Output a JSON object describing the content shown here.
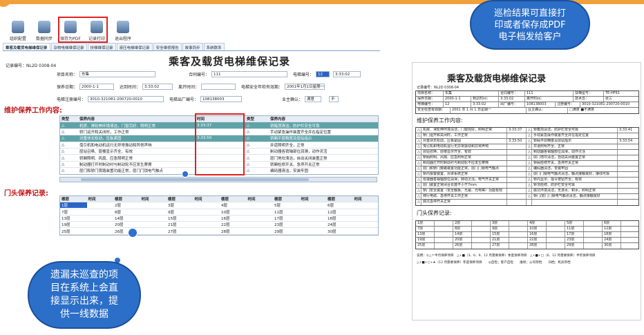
{
  "toolbar": {
    "buttons": [
      {
        "label": "组织配置",
        "icon": "organization-icon"
      },
      {
        "label": "数据同步",
        "icon": "sync-icon"
      },
      {
        "label": "保存为PDF",
        "icon": "save-pdf-icon"
      },
      {
        "label": "记录打印",
        "icon": "printer-icon"
      },
      {
        "label": "退出程序",
        "icon": "exit-icon"
      }
    ]
  },
  "tabs": [
    "乘客及载货电梯维保记录",
    "杂物电梯维保记录",
    "扶梯维保记录",
    "液压电梯维保记录",
    "安全维修报告",
    "故事同步",
    "系统联系"
  ],
  "form": {
    "record_no": "记录编号：NL2D 0308-04",
    "title": "乘客及载货电梯维保记录",
    "labels": {
      "project": "项目名称：",
      "contract": "合同编号：",
      "elevator_no": "电梯编号：",
      "date": "保养日期：",
      "arrive": "达到时间：",
      "leave": "离开时间：",
      "next_check": "电梯安全年检有效期：",
      "reg_code": "电梯注册编号：",
      "factory_no": "电梯出厂编号：",
      "owner": "业主确认："
    },
    "values": {
      "project": "东集",
      "contract": "111",
      "elevator_no": "12",
      "time1": "3:33:02",
      "date": "2000-1-1",
      "arrive": "3:33:02",
      "next_check": "2001年1月1日星期一",
      "reg_code": "3010-321081-200720-0010",
      "factory_no": "108138003",
      "owner_opts": [
        "满意",
        "不"
      ]
    }
  },
  "maintenance": {
    "title": "维护保养工作内容:",
    "headers": [
      "类型",
      "保养内容",
      "时间",
      "类型",
      "保养内容"
    ],
    "rows": [
      [
        "△",
        "机房、滑轮伸环境清洁，门窗完好、照明正常",
        "3:33:37",
        "△",
        "轿箱顶清洁，防护栏安全可靠"
      ],
      [
        "△",
        "轿门运开和关闭时，工作正常",
        "",
        "△",
        "手动紧急操作装置齐全并在指定位置"
      ],
      [
        "△",
        "对重块无松动，压板紧固",
        "3:33:50",
        "△",
        "轿厢平层精度及层站指示"
      ],
      [
        "△",
        "曳引机和电动机运行无异常振动和异常声响",
        "",
        "△",
        "井道照明齐全，正常"
      ],
      [
        "△",
        "层站召唤、层楼显示齐全、有效",
        "",
        "△",
        "制动器各销轴部位润滑，动作灵活"
      ],
      [
        "△",
        "轿厢照明、风扇、应急照明正常",
        "",
        "△",
        "层门地坎清洁，自动关闭装置正常"
      ],
      [
        "△",
        "制动器打开时制动衬与制动轮不应发生摩擦",
        "",
        "△",
        "轿厢检修开关、急停开关正常"
      ],
      [
        "△",
        "层门和轿门旁路装置功能正常，层门门锁电气触点",
        "",
        "△",
        "编码器清洁，安装牢固"
      ]
    ]
  },
  "door": {
    "title": "门头保养记录:",
    "headers": [
      "楼层",
      "时间",
      "楼层",
      "时间",
      "楼层",
      "时间",
      "楼层",
      "时间",
      "楼层",
      "时间",
      "楼层",
      "时间"
    ],
    "rows": [
      [
        "1层",
        "",
        "2层",
        "",
        "3层",
        "",
        "4层",
        "",
        "5层",
        "",
        "6层",
        ""
      ],
      [
        "7层",
        "",
        "8层",
        "",
        "9层",
        "",
        "10层",
        "",
        "11层",
        "",
        "12层",
        ""
      ],
      [
        "13层",
        "",
        "14层",
        "",
        "15层",
        "",
        "16层",
        "",
        "17层",
        "",
        "18层",
        ""
      ],
      [
        "19层",
        "",
        "20层",
        "",
        "21层",
        "",
        "22层",
        "",
        "23层",
        "",
        "24层",
        ""
      ],
      [
        "25层",
        "",
        "26层",
        "",
        "27层",
        "",
        "28层",
        "",
        "29层",
        "",
        "30层",
        ""
      ]
    ]
  },
  "paper": {
    "title": "乘客及载货电梯维保记录",
    "record_no": "记录编号：NL2D 0308-04",
    "info_rows": [
      [
        "项目名称：",
        "东集",
        "合同编号：",
        "111",
        "扶梯型号：",
        "TE-HF61"
      ],
      [
        "保养日期：",
        "2000-1-1",
        "到达时间：",
        "3:33:02",
        "离开时间：",
        "技术员：",
        "张三"
      ],
      [
        "电梯编号：",
        "12",
        "3:33:02",
        "出厂编号：",
        "108138003",
        "注册编号：",
        "3010-321081-200720-0010"
      ],
      [
        "安全检查有效期：",
        "2001 年 1 月 1 日星期一",
        "业主确认：",
        "□满意 ■不满意"
      ]
    ],
    "maint_title": "维护保养工作内容:",
    "maint_rows": [
      [
        "△",
        "机房、滑轮伸环境清洁，门窗完好，照明正常",
        "3:33:37",
        "△",
        "轿箱顶清洁，防护栏安全可靠",
        "3:33:41"
      ],
      [
        "△",
        "轿门运开和关闭时，工作正常",
        "",
        "△",
        "手动紧急操作装置齐全并在指定位置",
        ""
      ],
      [
        "△",
        "对重块无松动，压板紧固",
        "3:33:50",
        "△",
        "轿厢平层精度及层站指示",
        "3:33:54"
      ],
      [
        "△",
        "曳引机和电动机运行无异常振动和异常声响",
        "",
        "△",
        "井道照明齐全、正常",
        ""
      ],
      [
        "△",
        "层站召唤、层楼显示齐全、有效",
        "",
        "△",
        "制动器各销轴部位润滑，动作灵活",
        ""
      ],
      [
        "△",
        "轿厢照明、风扇、应急照明正常",
        "",
        "△",
        "层门地坎清洁，自动关闭装置正常",
        ""
      ],
      [
        "△",
        "制动器打开时制动衬与制动轮不应发生摩擦",
        "",
        "△",
        "轿厢检修开关、急停开关正常",
        ""
      ],
      [
        "△",
        "层门和轿门旁路装置功能正常，层门门锁电气触点",
        "",
        "△",
        "编码器清洁，安装牢固",
        ""
      ],
      [
        "△",
        "轿内报警装置、对讲系统正常",
        "",
        "△",
        "层门门锁电气触点清洁，触点接触良好，接线可靠",
        ""
      ],
      [
        "△",
        "限速器各销轴部位润滑，转动灵活，电气开关正常",
        "",
        "△",
        "轿内显示、指令按钮齐全、有效",
        ""
      ],
      [
        "△",
        "层门装置正常闭合长度不小于7mm",
        "",
        "△",
        "轿顶检修、防护栏安全可靠",
        ""
      ],
      [
        "△",
        "轿门安全装置（安全触板、光幕、光电等）功能有效",
        "",
        "△",
        "底坑环境清洁，无渗水、积水，照明正常",
        ""
      ],
      [
        "△",
        "随行电缆、急停开关工作正常",
        "",
        "△",
        "轿门/层门门锁电气触点清洁，触点接触良好",
        ""
      ],
      [
        "△",
        "底坑急停开关正常",
        "",
        "",
        "",
        ""
      ]
    ],
    "door_title": "门头保养记录:",
    "door_rows": [
      [
        "1层",
        "",
        "2层",
        "",
        "3层",
        "",
        "4层",
        "",
        "5层",
        "",
        "6层",
        ""
      ],
      [
        "7层",
        "",
        "8层",
        "",
        "9层",
        "",
        "10层",
        "",
        "11层",
        "",
        "12层",
        ""
      ],
      [
        "13层",
        "",
        "14层",
        "",
        "15层",
        "",
        "16层",
        "",
        "17层",
        "",
        "18层",
        ""
      ],
      [
        "19层",
        "",
        "20层",
        "",
        "21层",
        "",
        "22层",
        "",
        "23层",
        "",
        "24层",
        ""
      ],
      [
        "25层",
        "",
        "26层",
        "",
        "27层",
        "",
        "28层",
        "",
        "29层",
        "",
        "30层",
        ""
      ]
    ],
    "note1": "说明：①△＝半月保养项目　△+■（3、6、9、12 月需要保养）季度保养项目　△+■+□（6、12 月需要保养）半年保养项目",
    "note2": "△+■+○+★（12 月需要保养）年度保养项目　　◎自检；客户自检　　维修；公司存档　　归档；机房存档"
  },
  "callouts": {
    "top_right": [
      "巡检结果可直接打",
      "印或者保存成PDF",
      "电子档发给客户"
    ],
    "bottom_left": [
      "遗漏未巡查的项",
      "目在系统上会直",
      "接显示出来，提",
      "供一线数据"
    ]
  }
}
